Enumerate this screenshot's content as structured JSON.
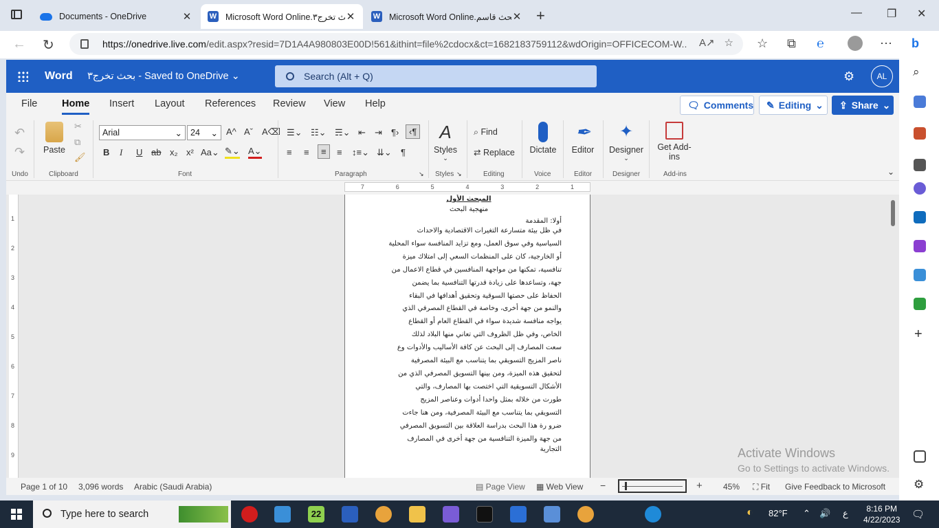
{
  "browser": {
    "tabs": [
      {
        "title": "Documents - OneDrive",
        "favicon": "onedrive-icon",
        "active": false
      },
      {
        "title": "Microsoft Word Online.بحث تخرج٣",
        "favicon": "word-icon",
        "active": true
      },
      {
        "title": "Microsoft Word Online.بحث قاسم",
        "favicon": "word-icon",
        "active": false
      }
    ],
    "url_host": "https://onedrive.live.com",
    "url_path": "/edit.aspx?resid=7D1A4A980803E00D!561&ithint=file%2cdocx&ct=1682183759112&wdOrigin=OFFICECOM-W..."
  },
  "word": {
    "app_name": "Word",
    "doc_title": "بحث تخرج٣ - Saved to OneDrive",
    "search_placeholder": "Search (Alt + Q)",
    "user_initials": "AL",
    "ribbon_tabs": [
      "File",
      "Home",
      "Insert",
      "Layout",
      "References",
      "Review",
      "View",
      "Help"
    ],
    "active_tab": "Home",
    "comments_label": "Comments",
    "editing_label": "Editing",
    "share_label": "Share",
    "groups": {
      "undo": "Undo",
      "clipboard": "Clipboard",
      "font": "Font",
      "paragraph": "Paragraph",
      "styles": "Styles",
      "editing": "Editing",
      "voice": "Voice",
      "editor": "Editor",
      "designer": "Designer",
      "addins": "Add-ins"
    },
    "buttons": {
      "paste": "Paste",
      "styles": "Styles",
      "find": "Find",
      "replace": "Replace",
      "dictate": "Dictate",
      "editor": "Editor",
      "designer": "Designer",
      "get_addins": "Get Add-ins"
    },
    "font_name": "Arial",
    "font_size": "24",
    "ruler_numbers": [
      "7",
      "6",
      "5",
      "4",
      "3",
      "2",
      "1"
    ],
    "vruler_numbers": [
      "1",
      "2",
      "3",
      "4",
      "5",
      "6",
      "7",
      "8",
      "9"
    ]
  },
  "document": {
    "heading": "المبحث الأول",
    "subheading": "منهجية البحث",
    "section": "أولا: المقدمة",
    "lines": [
      "في ظل بيئة متسارعة التغيرات الاقتصادية والاحداث",
      "السياسية وفي سوق العمل، ومع تزايد المنافسة سواء المحلية",
      "أو الخارجية، كان على المنظمات السعي إلى امتلاك ميزة",
      "تنافسية، تمكنها من مواجهة المنافسين في قطاع الاعمال من",
      "جهة، وتساعدها على زيادة قدرتها التنافسية بما يضمن",
      "الحفاظ على حصتها السوقية وتحقيق أهدافها في البقاء",
      "والنمو من جهة أخرى، وخاصة في القطاع المصرفي الذي",
      "يواجه منافسة شديدة سواء في القطاع العام أو القطاع",
      "الخاص، وفي ظل الظروف التي تعاني منها البلاد لذلك",
      "سعت المصارف إلى البحث عن كافة الأساليب والأدوات وع",
      "ناصر المزيج التسويقي بما يتناسب مع البيئة المصرفية",
      "لتحقيق هذه الميزة، ومن بينها التسويق المصرفي الذي من",
      "الأشكال التسويقية التي اختصت بها المصارف، والتي",
      "طورت من خلاله بمثل واحدا أدوات وعناصر المزيج",
      "التسويقي بما يتناسب مع البيئة المصرفية، ومن هنا جاءت",
      "ضرو رة هذا البحث بدراسة العلاقة بين التسويق المصرفي",
      "من جهة والميزة التنافسية من جهة أخرى في المصارف"
    ],
    "last_line": "التجارية"
  },
  "watermark": {
    "line1": "Activate Windows",
    "line2": "Go to Settings to activate Windows."
  },
  "status": {
    "page": "Page 1 of 10",
    "words": "3,096 words",
    "language": "Arabic (Saudi Arabia)",
    "page_view": "Page View",
    "web_view": "Web View",
    "zoom": "45%",
    "fit": "Fit",
    "feedback": "Give Feedback to Microsoft"
  },
  "taskbar": {
    "search_placeholder": "Type here to search",
    "weather": "82°F",
    "lang": "ع",
    "time": "8:16 PM",
    "date": "4/22/2023"
  },
  "colors": {
    "word_blue": "#1f5fc4",
    "taskbar": "#1d2a3a"
  }
}
